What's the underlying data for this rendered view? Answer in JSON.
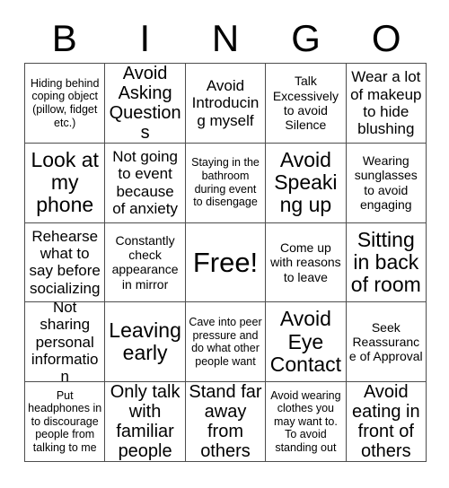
{
  "card": {
    "title": "BINGO",
    "header_letters": [
      "B",
      "I",
      "N",
      "G",
      "O"
    ],
    "grid_size": 5,
    "colors": {
      "text": "#000000",
      "border": "#4d4d4d",
      "background": "#ffffff"
    },
    "cells": [
      {
        "text": "Hiding behind coping object (pillow, fidget etc.)",
        "size": "xs",
        "free": false
      },
      {
        "text": "Avoid Asking Questions",
        "size": "l",
        "free": false
      },
      {
        "text": "Avoid Introducing myself",
        "size": "m",
        "free": false
      },
      {
        "text": "Talk Excessively to avoid Silence",
        "size": "s",
        "free": false
      },
      {
        "text": "Wear a lot of makeup to hide blushing",
        "size": "m",
        "free": false
      },
      {
        "text": "Look at my phone",
        "size": "xl",
        "free": false
      },
      {
        "text": "Not going to event because of anxiety",
        "size": "m",
        "free": false
      },
      {
        "text": "Staying in the bathroom during event to disengage",
        "size": "xs",
        "free": false
      },
      {
        "text": "Avoid Speaking up",
        "size": "xl",
        "free": false
      },
      {
        "text": "Wearing sunglasses to avoid engaging",
        "size": "s",
        "free": false
      },
      {
        "text": "Rehearse what to say before socializing",
        "size": "m",
        "free": false
      },
      {
        "text": "Constantly check appearance in mirror",
        "size": "s",
        "free": false
      },
      {
        "text": "Free!",
        "size": "xxl",
        "free": true
      },
      {
        "text": "Come up with reasons to leave",
        "size": "s",
        "free": false
      },
      {
        "text": "Sitting in back of room",
        "size": "xl",
        "free": false
      },
      {
        "text": "Not sharing personal information",
        "size": "m",
        "free": false
      },
      {
        "text": "Leaving early",
        "size": "xl",
        "free": false
      },
      {
        "text": "Cave into peer pressure and do what other people want",
        "size": "xs",
        "free": false
      },
      {
        "text": "Avoid Eye Contact",
        "size": "xl",
        "free": false
      },
      {
        "text": "Seek Reassurance of Approval",
        "size": "s",
        "free": false
      },
      {
        "text": "Put headphones in to discourage people from talking to me",
        "size": "xs",
        "free": false
      },
      {
        "text": "Only talk with familiar people",
        "size": "l",
        "free": false
      },
      {
        "text": "Stand far away from others",
        "size": "l",
        "free": false
      },
      {
        "text": "Avoid wearing clothes you may want to. To avoid standing out",
        "size": "xs",
        "free": false
      },
      {
        "text": "Avoid eating in front of others",
        "size": "l",
        "free": false
      }
    ]
  }
}
